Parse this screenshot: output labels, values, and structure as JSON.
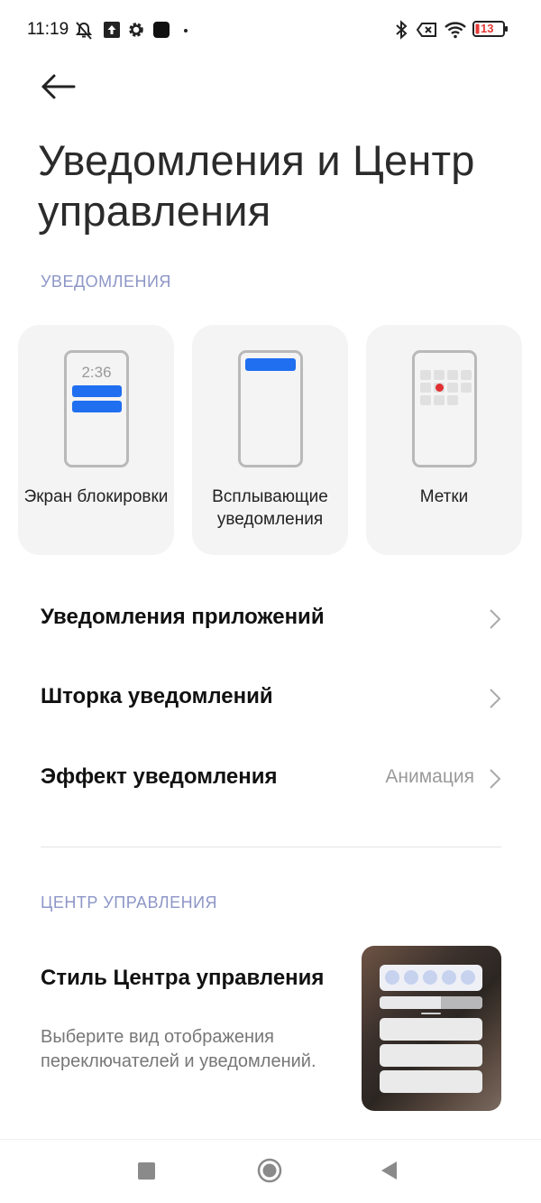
{
  "status_bar": {
    "time": "11:19",
    "battery": "13",
    "icons": [
      "bell-off-icon",
      "upload-icon",
      "gear-icon",
      "square-icon",
      "dot-icon",
      "bluetooth-icon",
      "no-sim-icon",
      "wifi-icon",
      "battery-icon"
    ]
  },
  "page": {
    "title": "Уведомления и Центр управления"
  },
  "notifications_section": {
    "label": "УВЕДОМЛЕНИЯ",
    "cards": [
      {
        "label": "Экран блокировки",
        "clock": "2:36"
      },
      {
        "label": "Всплывающие уведомления"
      },
      {
        "label": "Метки"
      }
    ],
    "rows": [
      {
        "label": "Уведомления приложений",
        "value": ""
      },
      {
        "label": "Шторка уведомлений",
        "value": ""
      },
      {
        "label": "Эффект уведомления",
        "value": "Анимация"
      }
    ]
  },
  "control_center_section": {
    "label": "ЦЕНТР УПРАВЛЕНИЯ",
    "style_title": "Стиль Центра управления",
    "style_desc": "Выберите вид отображения переключателей и уведомлений."
  },
  "colors": {
    "accent_blue": "#1f6ff0",
    "section_label": "#8d96c7",
    "badge_red": "#e03030",
    "battery_red": "#e53935"
  },
  "nav_bar": {
    "icons": [
      "recents-square-icon",
      "home-circle-icon",
      "back-triangle-icon"
    ]
  }
}
